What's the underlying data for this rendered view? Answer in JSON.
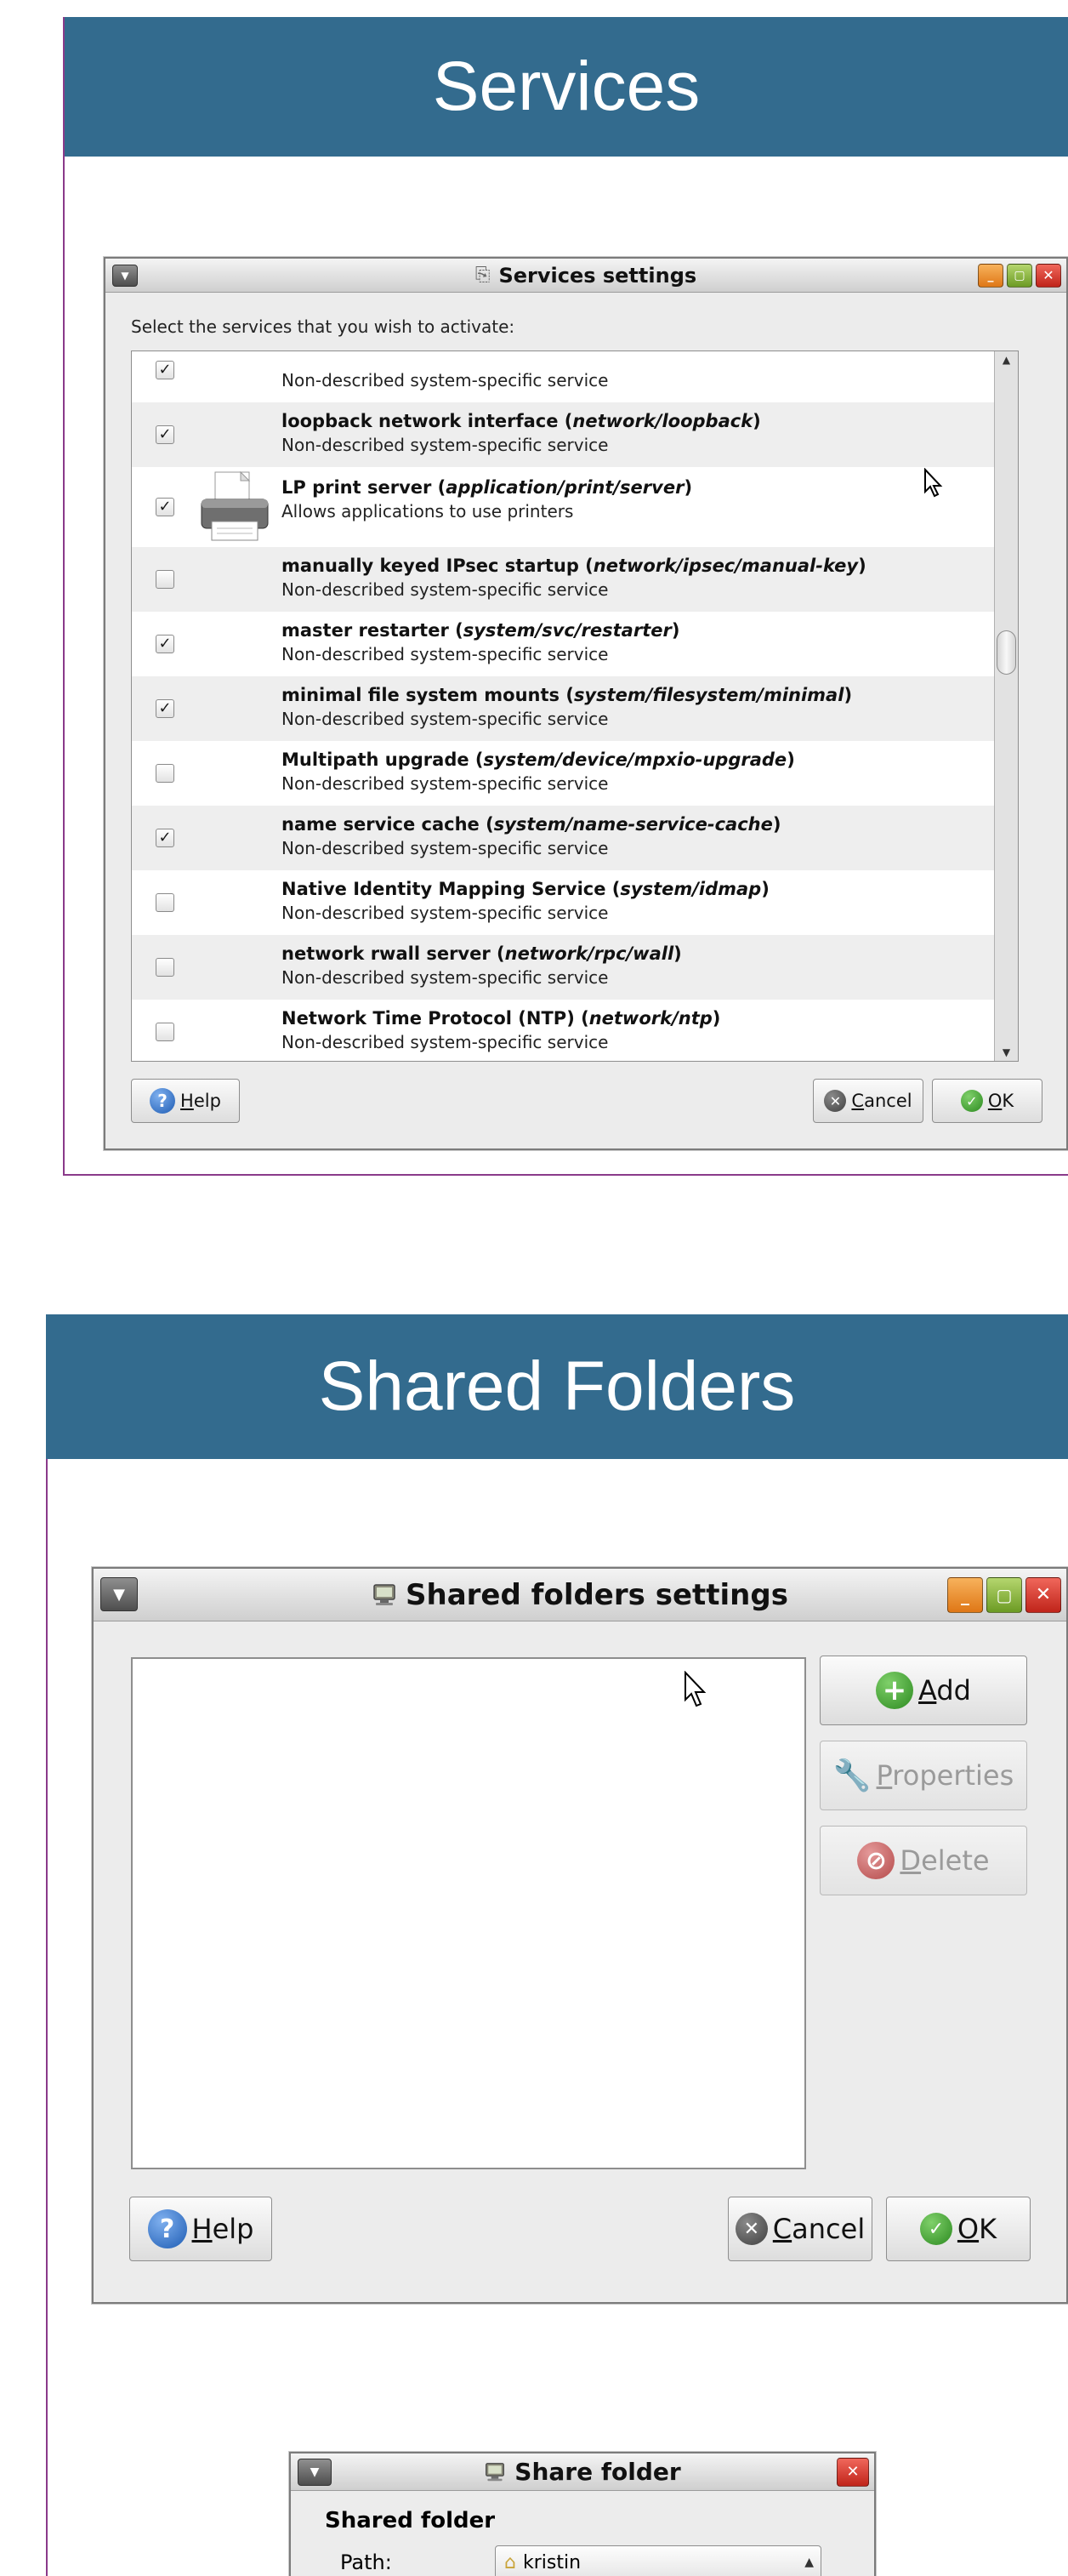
{
  "services_section": {
    "heading": "Services",
    "window": {
      "title": "Services settings",
      "instruction": "Select the services that you wish to activate:",
      "items": [
        {
          "title_plain": "",
          "title_fmri": "",
          "title_end": "",
          "description": "Non-described system-specific service",
          "checked": true
        },
        {
          "title_plain": "loopback network interface (",
          "title_fmri": "network/loopback",
          "title_end": ")",
          "description": "Non-described system-specific service",
          "checked": true
        },
        {
          "title_plain": "LP print server (",
          "title_fmri": "application/print/server",
          "title_end": ")",
          "description": "Allows applications to use printers",
          "checked": true,
          "icon": "printer-icon"
        },
        {
          "title_plain": "manually keyed IPsec startup (",
          "title_fmri": "network/ipsec/manual-key",
          "title_end": ")",
          "description": "Non-described system-specific service",
          "checked": false
        },
        {
          "title_plain": "master restarter (",
          "title_fmri": "system/svc/restarter",
          "title_end": ")",
          "description": "Non-described system-specific service",
          "checked": true
        },
        {
          "title_plain": "minimal file system mounts (",
          "title_fmri": "system/filesystem/minimal",
          "title_end": ")",
          "description": "Non-described system-specific service",
          "checked": true
        },
        {
          "title_plain": "Multipath upgrade (",
          "title_fmri": "system/device/mpxio-upgrade",
          "title_end": ")",
          "description": "Non-described system-specific service",
          "checked": false
        },
        {
          "title_plain": "name service cache (",
          "title_fmri": "system/name-service-cache",
          "title_end": ")",
          "description": "Non-described system-specific service",
          "checked": true
        },
        {
          "title_plain": "Native Identity Mapping Service (",
          "title_fmri": "system/idmap",
          "title_end": ")",
          "description": "Non-described system-specific service",
          "checked": false
        },
        {
          "title_plain": "network rwall server (",
          "title_fmri": "network/rpc/wall",
          "title_end": ")",
          "description": "Non-described system-specific service",
          "checked": false
        },
        {
          "title_plain": "Network Time Protocol (NTP) (",
          "title_fmri": "network/ntp",
          "title_end": ")",
          "description": "Non-described system-specific service",
          "checked": false
        }
      ],
      "buttons": {
        "help": {
          "mnemonic": "H",
          "rest": "elp"
        },
        "cancel": {
          "mnemonic": "C",
          "rest": "ancel"
        },
        "ok": {
          "mnemonic": "O",
          "rest": "K"
        }
      }
    }
  },
  "shared_folders_section": {
    "heading": "Shared Folders",
    "window": {
      "title": "Shared folders settings",
      "buttons": {
        "add": {
          "mnemonic": "A",
          "rest": "dd",
          "enabled": true
        },
        "properties": {
          "mnemonic": "P",
          "rest": "roperties",
          "enabled": false
        },
        "delete": {
          "mnemonic": "D",
          "rest": "elete",
          "enabled": false
        },
        "help": {
          "mnemonic": "H",
          "rest": "elp"
        },
        "cancel": {
          "mnemonic": "C",
          "rest": "ancel"
        },
        "ok": {
          "mnemonic": "O",
          "rest": "K"
        }
      }
    },
    "share_dialog": {
      "title": "Share folder",
      "group_label": "Shared folder",
      "path_label": "Path:",
      "path_value": "kristin"
    }
  },
  "colors": {
    "banner": "#336b8e",
    "frame_accent": "#8a3a8a",
    "close": "#c0241a",
    "minimize": "#df7716",
    "maximize": "#6c9b24"
  }
}
